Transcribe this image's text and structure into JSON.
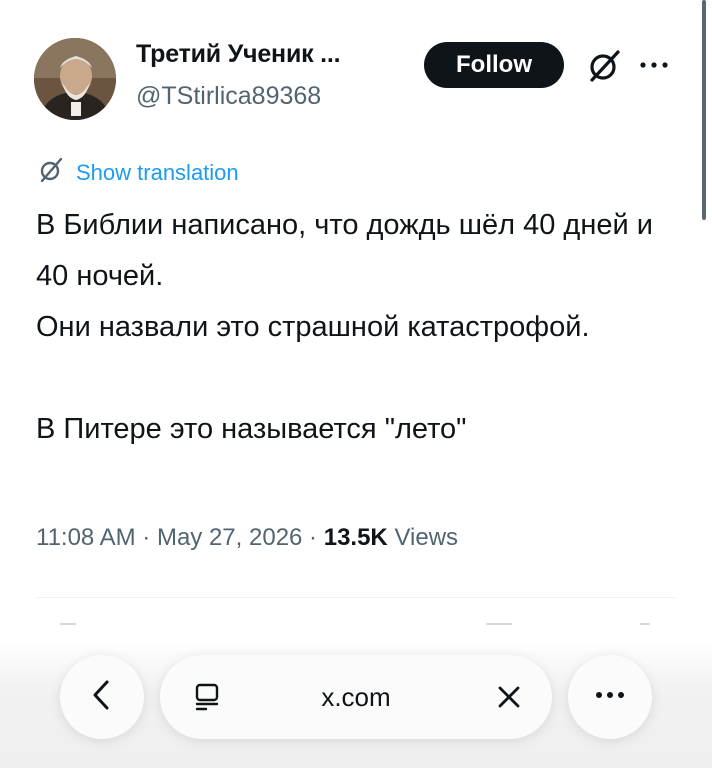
{
  "tweet": {
    "author_name": "Третий Ученик ...",
    "author_handle": "@TStirlica89368",
    "follow_label": "Follow",
    "translate_label": "Show translation",
    "body_lines": [
      "В Библии написано, что дождь шёл 40 дней и 40 ночей.",
      "Они назвали это страшной катастрофой."
    ],
    "body_punchline": "В Питере это называется \"лето\"",
    "time": "11:08 AM",
    "separator": " · ",
    "date": "May 27, 2026",
    "view_count": "13.5K",
    "views_label": "Views"
  },
  "browser": {
    "url": "x.com"
  },
  "icons": {
    "back": "chevron-left-icon",
    "reader": "reader-mode-icon",
    "close": "close-icon",
    "more": "more-horizontal-icon",
    "grok": "grok-icon"
  },
  "colors": {
    "link": "#1d9bf0",
    "secondary_text": "#536471",
    "primary_text": "#0f1419",
    "follow_bg": "#0f1419"
  }
}
